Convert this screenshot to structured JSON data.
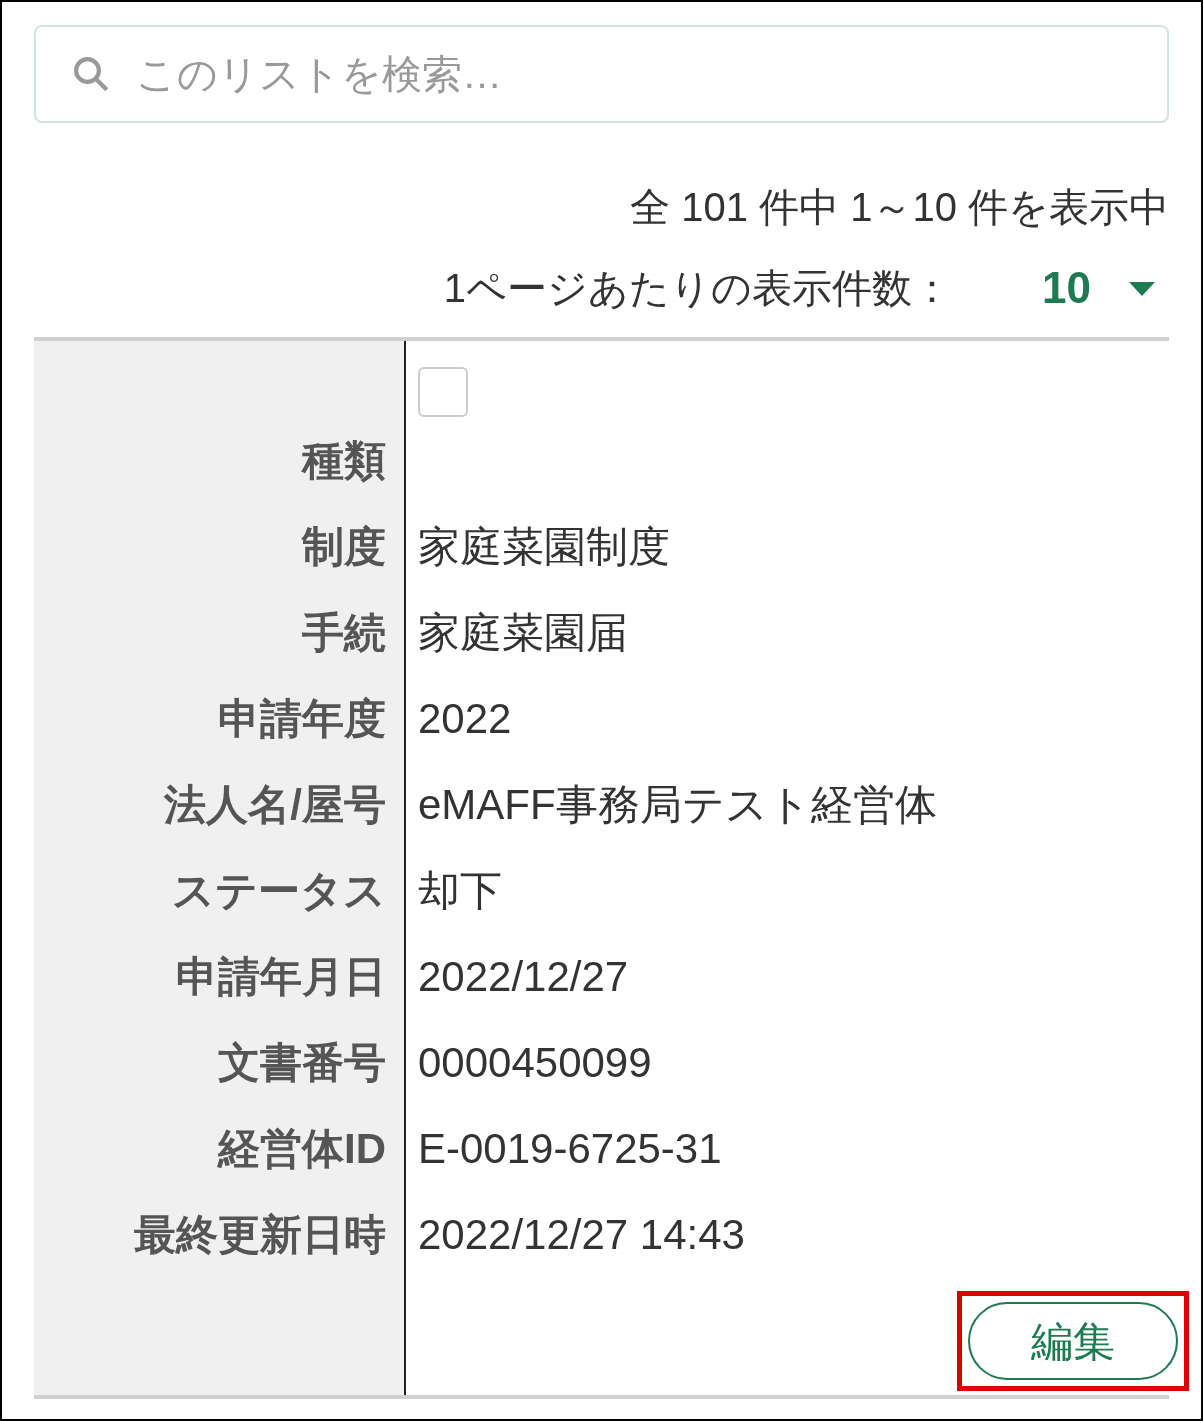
{
  "search": {
    "placeholder": "このリストを検索…"
  },
  "summary": "全 101 件中 1～10 件を表示中",
  "per_page": {
    "label": "1ページあたりの表示件数：",
    "value": "10"
  },
  "record": {
    "checked": false,
    "fields": [
      {
        "label": "種類"
      },
      {
        "label": "制度",
        "value": "家庭菜園制度"
      },
      {
        "label": "手続",
        "value": "家庭菜園届"
      },
      {
        "label": "申請年度",
        "value": "2022"
      },
      {
        "label": "法人名/屋号",
        "value": "eMAFF事務局テスト経営体"
      },
      {
        "label": "ステータス",
        "value": "却下"
      },
      {
        "label": "申請年月日",
        "value": "2022/12/27"
      },
      {
        "label": "文書番号",
        "value": "0000450099"
      },
      {
        "label": "経営体ID",
        "value": "E-0019-6725-31"
      },
      {
        "label": "最終更新日時",
        "value": "2022/12/27 14:43"
      }
    ],
    "button": {
      "label": "編集",
      "highlighted": true
    }
  }
}
